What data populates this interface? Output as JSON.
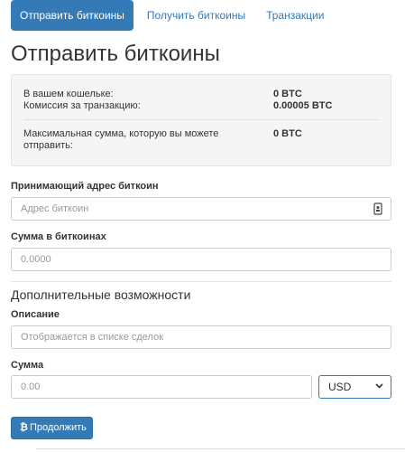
{
  "tabs": [
    {
      "label": "Отправить биткоины"
    },
    {
      "label": "Получить биткоины"
    },
    {
      "label": "Транзакции"
    }
  ],
  "page": {
    "title": "Отправить биткоины"
  },
  "wallet": {
    "balance_label": "В вашем кошельке:",
    "balance_value": "0 BTC",
    "fee_label": "Комиссия за транзакцию:",
    "fee_value": "0.00005 BTC",
    "max_label_line1": "Максимальная сумма, которую вы можете",
    "max_label_line2": "отправить:",
    "max_value": "0 BTC"
  },
  "form": {
    "address_label": "Принимающий адрес биткоин",
    "address_placeholder": "Адрес биткоин",
    "amount_btc_label": "Сумма в биткоинах",
    "amount_btc_placeholder": "0.0000",
    "extra_title": "Дополнительные возможности",
    "description_label": "Описание",
    "description_placeholder": "Отображается в списке сделок",
    "amount_label": "Сумма",
    "amount_placeholder": "0.00",
    "currency_value": "USD",
    "continue_icon": "₿",
    "continue_label": "Продолжить"
  },
  "colors": {
    "accent": "#337ab7",
    "panel_bg": "#f5f5f5"
  },
  "icons": {
    "address_field": "contacts-book-icon",
    "currency_select": "chevron-down-icon",
    "continue": "bitcoin-icon"
  }
}
